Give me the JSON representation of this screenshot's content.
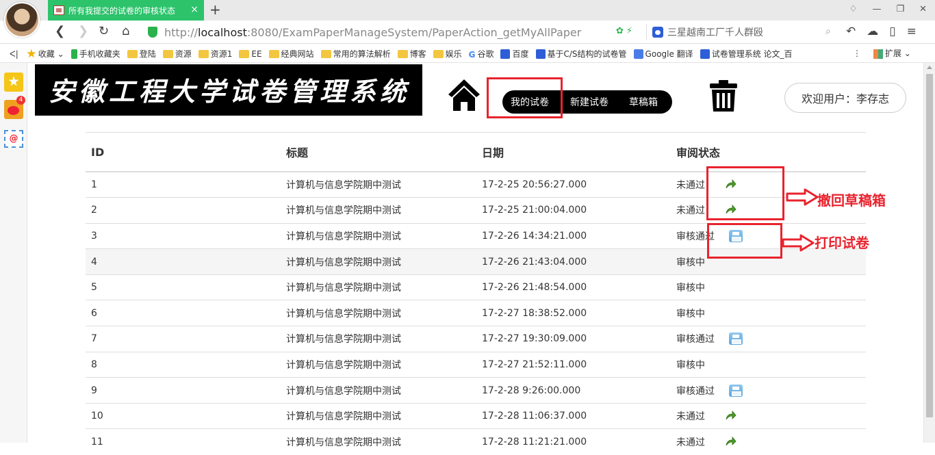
{
  "browser": {
    "tab_title": "所有我提交的试卷的审核状态",
    "tab_close": "×",
    "new_tab": "+",
    "url_prefix": "http://",
    "url_host": "localhost",
    "url_rest": ":8080/ExamPaperManageSystem/PaperAction_getMyAllPaper",
    "search_text": "三星越南工厂千人群殴",
    "accent_color": "#2cc36b"
  },
  "bookmarks": {
    "items": [
      {
        "label": "收藏",
        "icon": "star-icon"
      },
      {
        "label": "手机收藏夹",
        "icon": "phone-icon"
      },
      {
        "label": "登陆",
        "icon": "folder-icon"
      },
      {
        "label": "资源",
        "icon": "folder-icon"
      },
      {
        "label": "资源1",
        "icon": "folder-icon"
      },
      {
        "label": "EE",
        "icon": "folder-icon"
      },
      {
        "label": "经典网站",
        "icon": "folder-icon"
      },
      {
        "label": "常用的算法解析",
        "icon": "folder-icon"
      },
      {
        "label": "博客",
        "icon": "folder-icon"
      },
      {
        "label": "娱乐",
        "icon": "folder-icon"
      },
      {
        "label": "谷歌",
        "icon": "google-icon"
      },
      {
        "label": "百度",
        "icon": "paw-icon"
      },
      {
        "label": "基于C/S结构的试卷管",
        "icon": "paw-icon"
      },
      {
        "label": "Google 翻译",
        "icon": "translate-icon"
      },
      {
        "label": "试卷管理系统 论文_百",
        "icon": "paw-icon"
      }
    ],
    "extensions_label": "扩展"
  },
  "sidebar": {
    "weibo_badge": "4",
    "mail_glyph": "@"
  },
  "header": {
    "logo_text": "安徽工程大学试卷管理系统",
    "nav": {
      "my_papers": "我的试卷",
      "new_paper": "新建试卷",
      "drafts": "草稿箱"
    },
    "welcome": "欢迎用户：李存志"
  },
  "table": {
    "headers": [
      "ID",
      "标题",
      "日期",
      "审阅状态"
    ],
    "rows": [
      {
        "id": "1",
        "title": "计算机与信息学院期中测试",
        "date": "17-2-25 20:56:27.000",
        "status": "未通过",
        "action": "recall"
      },
      {
        "id": "2",
        "title": "计算机与信息学院期中测试",
        "date": "17-2-25 21:00:04.000",
        "status": "未通过",
        "action": "recall"
      },
      {
        "id": "3",
        "title": "计算机与信息学院期中测试",
        "date": "17-2-26 14:34:21.000",
        "status": "审核通过",
        "action": "print"
      },
      {
        "id": "4",
        "title": "计算机与信息学院期中测试",
        "date": "17-2-26 21:43:04.000",
        "status": "审核中",
        "action": "none"
      },
      {
        "id": "5",
        "title": "计算机与信息学院期中测试",
        "date": "17-2-26 21:48:54.000",
        "status": "审核中",
        "action": "none"
      },
      {
        "id": "6",
        "title": "计算机与信息学院期中测试",
        "date": "17-2-27 18:38:52.000",
        "status": "审核中",
        "action": "none"
      },
      {
        "id": "7",
        "title": "计算机与信息学院期中测试",
        "date": "17-2-27 19:30:09.000",
        "status": "审核通过",
        "action": "print"
      },
      {
        "id": "8",
        "title": "计算机与信息学院期中测试",
        "date": "17-2-27 21:52:11.000",
        "status": "审核中",
        "action": "none"
      },
      {
        "id": "9",
        "title": "计算机与信息学院期中测试",
        "date": "17-2-28 9:26:00.000",
        "status": "审核通过",
        "action": "print"
      },
      {
        "id": "10",
        "title": "计算机与信息学院期中测试",
        "date": "17-2-28 11:06:37.000",
        "status": "未通过",
        "action": "recall"
      },
      {
        "id": "11",
        "title": "计算机与信息学院期中测试",
        "date": "17-2-28 11:21:21.000",
        "status": "未通过",
        "action": "recall"
      }
    ]
  },
  "annotations": {
    "recall_label": "撤回草稿箱",
    "print_label": "打印试卷",
    "color": "#e8232e"
  }
}
